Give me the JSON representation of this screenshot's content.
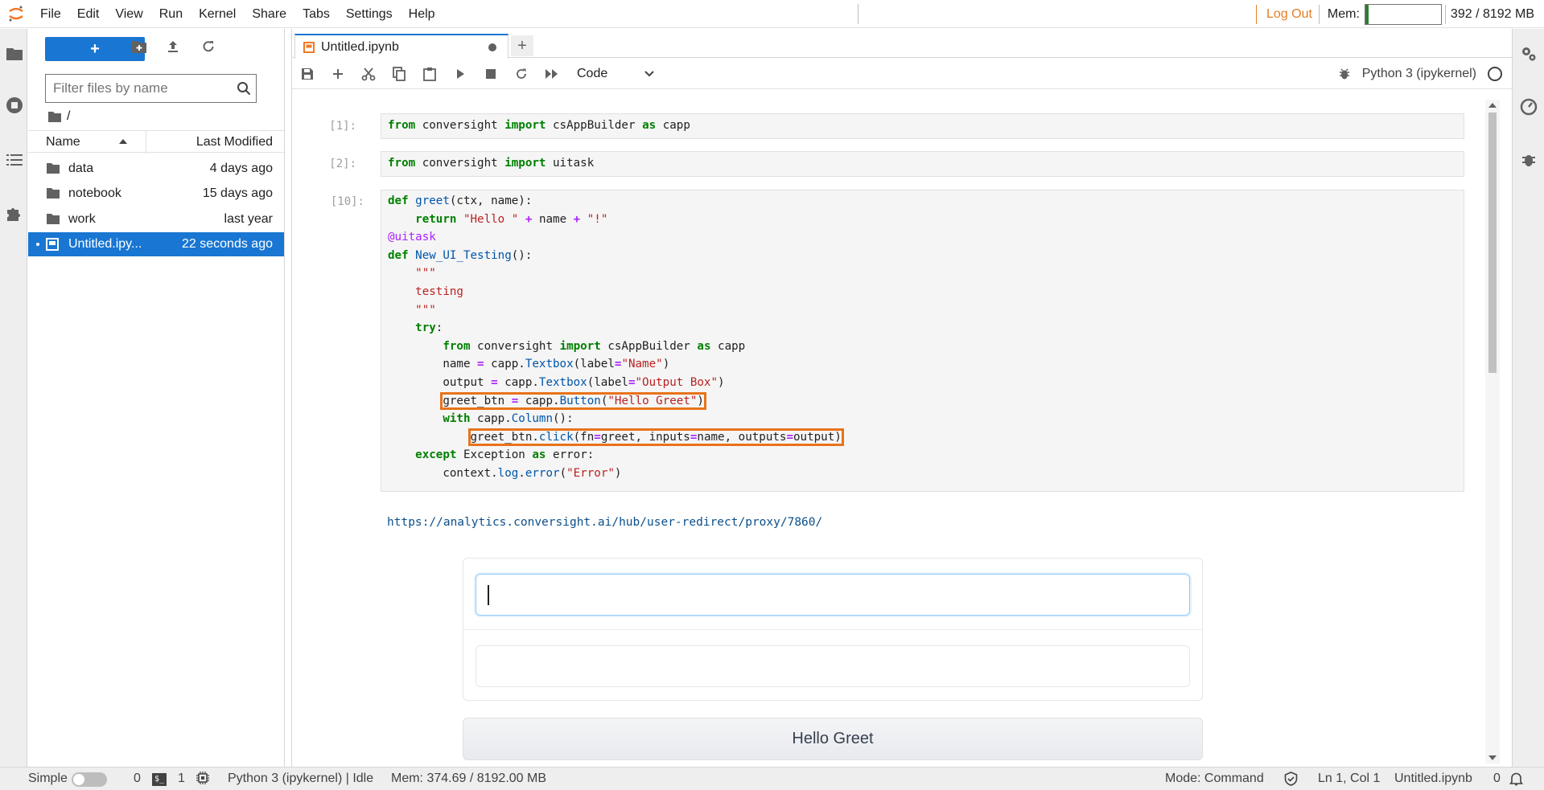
{
  "menubar": {
    "items": [
      "File",
      "Edit",
      "View",
      "Run",
      "Kernel",
      "Share",
      "Tabs",
      "Settings",
      "Help"
    ],
    "logout": "Log Out",
    "mem_label": "Mem:",
    "mem_text": "392 / 8192 MB",
    "mem_fraction": 0.048
  },
  "filebrowser": {
    "new_label": "+",
    "filter_placeholder": "Filter files by name",
    "breadcrumb": "/",
    "col_name": "Name",
    "col_modified": "Last Modified",
    "items": [
      {
        "name": "data",
        "modified": "4 days ago",
        "kind": "folder"
      },
      {
        "name": "notebook",
        "modified": "15 days ago",
        "kind": "folder"
      },
      {
        "name": "work",
        "modified": "last year",
        "kind": "folder"
      },
      {
        "name": "Untitled.ipy...",
        "modified": "22 seconds ago",
        "kind": "notebook",
        "selected": true
      }
    ]
  },
  "tab": {
    "title": "Untitled.ipynb",
    "add": "+"
  },
  "toolbar": {
    "cell_type": "Code",
    "kernel_name": "Python 3 (ipykernel)"
  },
  "cells": {
    "c1_prompt": "[1]:",
    "c2_prompt": "[2]:",
    "c3_prompt": "[10]:",
    "link": "https://analytics.conversight.ai/hub/user-redirect/proxy/7860/"
  },
  "app": {
    "button_label": "Hello Greet"
  },
  "statusbar": {
    "mode_simple": "Simple",
    "count1": "0",
    "terminal_glyph": "$_",
    "count2": "1",
    "kernel_status": "Python 3 (ipykernel) | Idle",
    "mem": "Mem: 374.69 / 8192.00 MB",
    "mode": "Mode: Command",
    "position": "Ln 1, Col 1",
    "file": "Untitled.ipynb",
    "notifications": "0"
  }
}
